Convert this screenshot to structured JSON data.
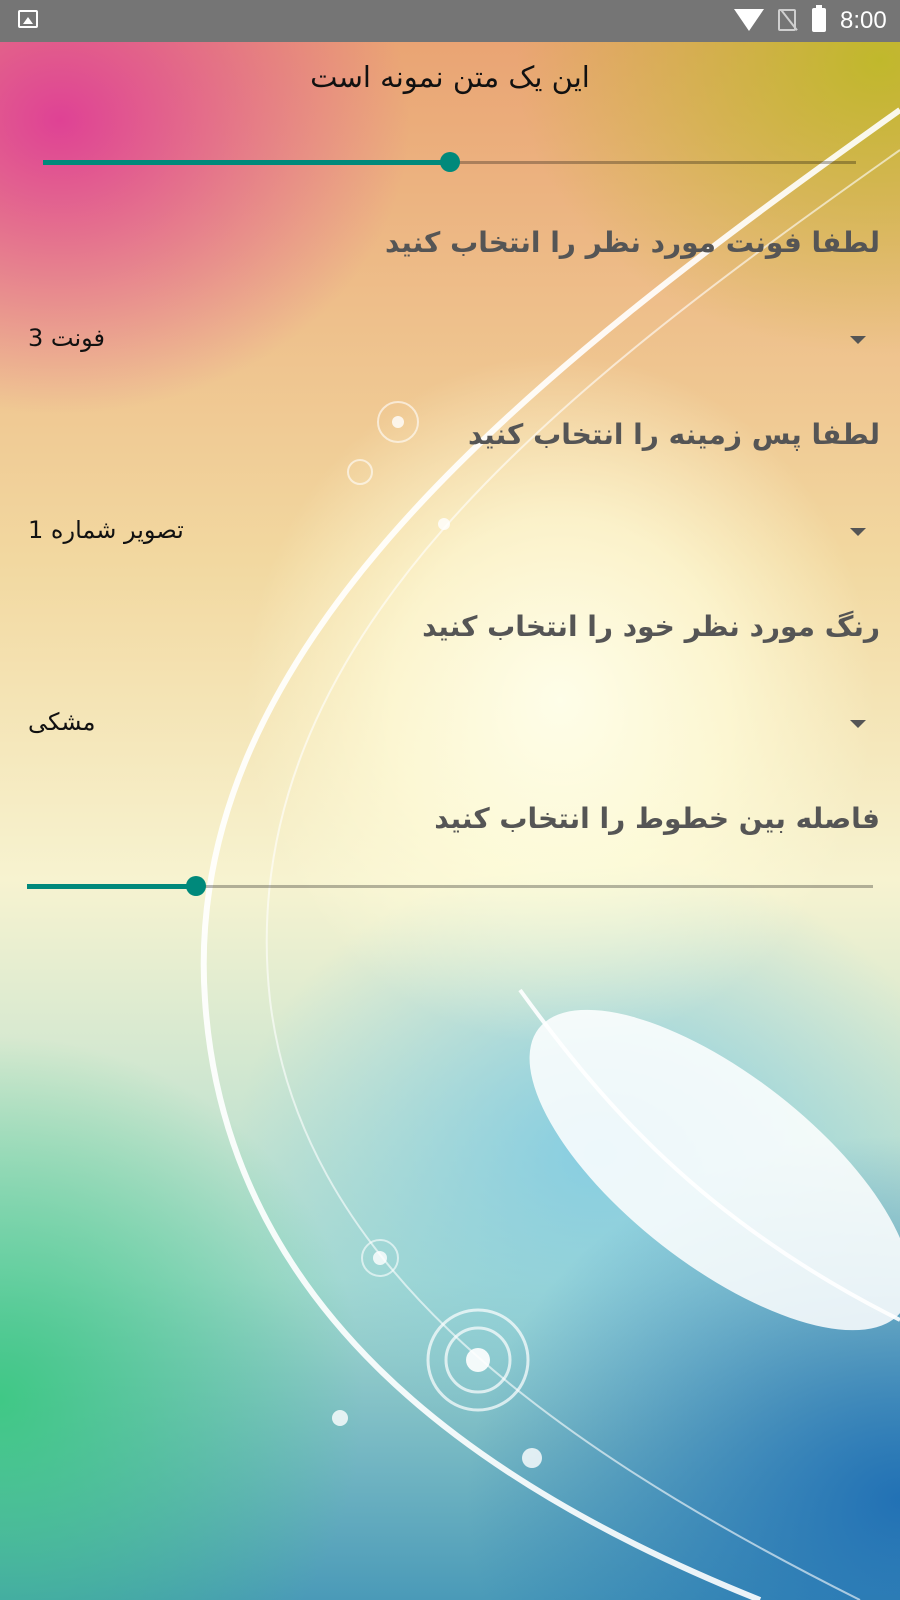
{
  "statusbar": {
    "time": "8:00"
  },
  "sample_text": "این یک متن نمونه است",
  "font_size_slider": {
    "value_fraction": 0.5
  },
  "font_section": {
    "heading": "لطفا فونت مورد نظر را انتخاب کنید",
    "selected": "فونت 3"
  },
  "background_section": {
    "heading": "لطفا پس زمینه را انتخاب کنید",
    "selected": "تصویر شماره 1"
  },
  "color_section": {
    "heading": "رنگ مورد نظر خود را انتخاب کنید",
    "selected": "مشکی"
  },
  "line_spacing_section": {
    "heading": "فاصله بین خطوط را انتخاب کنید"
  },
  "line_spacing_slider": {
    "value_fraction": 0.2
  },
  "icons": {
    "gallery": "image-icon",
    "wifi": "wifi-icon",
    "sim": "no-sim-icon",
    "battery": "battery-icon",
    "dropdown": "triangle-down-icon"
  },
  "colors": {
    "accent": "#00897b",
    "statusbar": "#757575"
  }
}
